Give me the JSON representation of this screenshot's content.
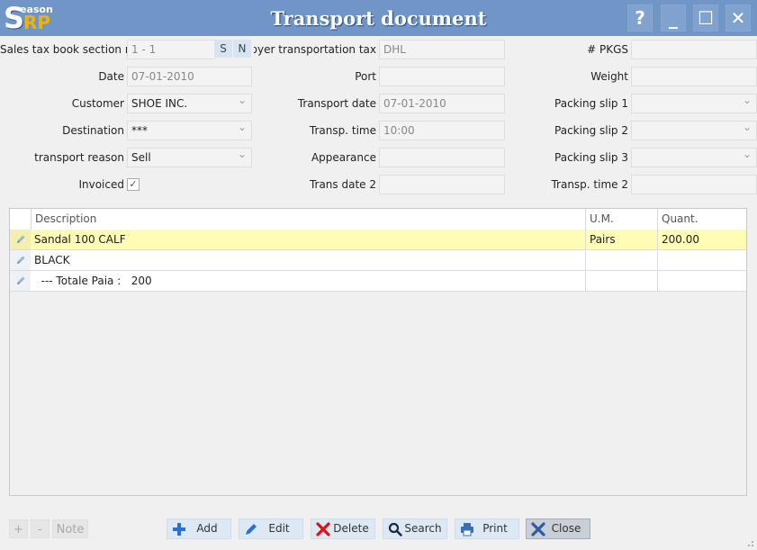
{
  "app": {
    "logo_s": "S",
    "logo_eason": "eason",
    "logo_rp": "RP",
    "title": "Transport document"
  },
  "window_buttons": {
    "help": "?",
    "minimize": "_",
    "maximize": "☐",
    "close": "✕"
  },
  "form": {
    "section_label": "Sales tax book section no.",
    "section_value": "1 - 1",
    "s_button": "S",
    "n_button": "N",
    "date_label": "Date",
    "date_value": "07-01-2010",
    "customer_label": "Customer",
    "customer_value": "SHOE INC.",
    "destination_label": "Destination",
    "destination_value": "***",
    "reason_label": "transport reason",
    "reason_value": "Sell",
    "invoiced_label": "Invoiced",
    "invoiced_check": "✓",
    "employer_label": "Employer transportation tax",
    "employer_value": "DHL",
    "port_label": "Port",
    "port_value": "",
    "transport_date_label": "Transport date",
    "transport_date_value": "07-01-2010",
    "transp_time_label": "Transp. time",
    "transp_time_value": "10:00",
    "appearance_label": "Appearance",
    "appearance_value": "",
    "trans_date2_label": "Trans date 2",
    "trans_date2_value": "",
    "pkgs_label": "# PKGS",
    "pkgs_value": "",
    "weight_label": "Weight",
    "weight_value": "",
    "packing1_label": "Packing slip 1",
    "packing1_value": "",
    "packing2_label": "Packing slip 2",
    "packing2_value": "",
    "packing3_label": "Packing slip 3",
    "packing3_value": "",
    "transp_time2_label": "Transp. time 2",
    "transp_time2_value": ""
  },
  "grid": {
    "columns": {
      "description": "Description",
      "um": "U.M.",
      "quant": "Quant."
    },
    "rows": [
      {
        "description": "Sandal 100 CALF",
        "um": "Pairs",
        "quant": "200.00"
      },
      {
        "description": "BLACK",
        "um": "",
        "quant": ""
      },
      {
        "description": "  --- Totale Paia :   200",
        "um": "",
        "quant": ""
      }
    ]
  },
  "footer": {
    "plus": "+",
    "minus": "-",
    "note": "Note",
    "add": "Add",
    "edit": "Edit",
    "delete": "Delete",
    "search": "Search",
    "print": "Print",
    "close": "Close"
  },
  "colors": {
    "titlebar": "#6f96c6",
    "selected_row": "#fffcb5",
    "add_icon": "#2a6fd6",
    "delete_icon": "#e01010"
  }
}
